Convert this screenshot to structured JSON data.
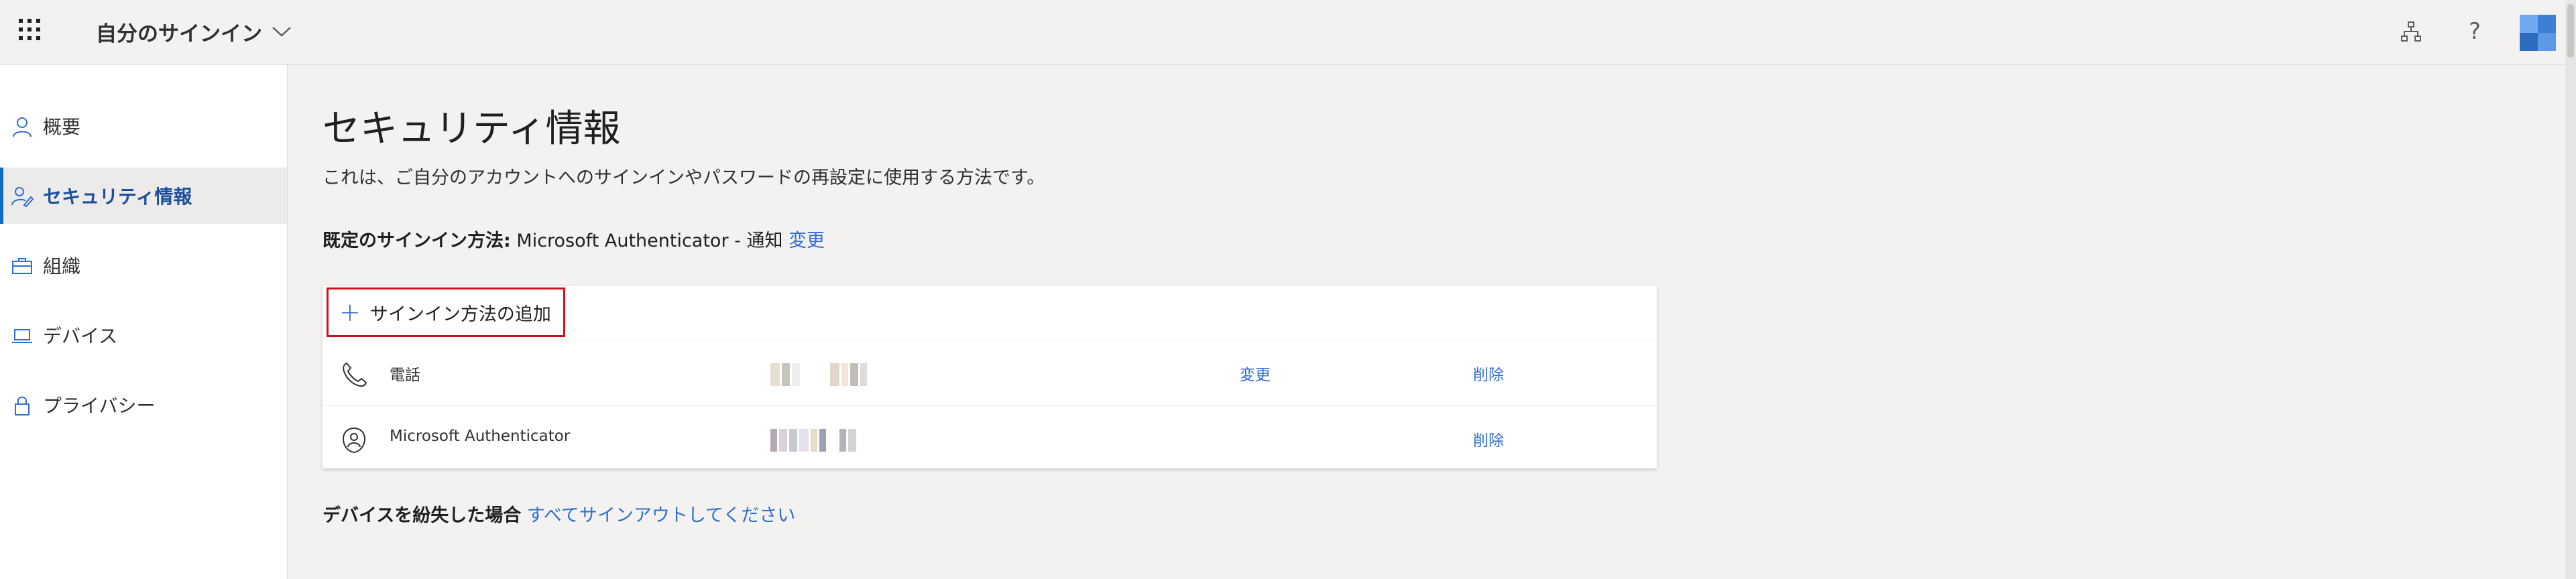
{
  "header": {
    "app_title": "自分のサインイン",
    "icons": [
      "waffle-icon",
      "chevron-down-icon",
      "org-chart-icon",
      "help-icon",
      "avatar"
    ],
    "help_label": "?"
  },
  "sidebar": {
    "items": [
      {
        "label": "概要",
        "icon": "person-icon",
        "active": false
      },
      {
        "label": "セキュリティ情報",
        "icon": "security-info-icon",
        "active": true
      },
      {
        "label": "組織",
        "icon": "briefcase-icon",
        "active": false
      },
      {
        "label": "デバイス",
        "icon": "laptop-icon",
        "active": false
      },
      {
        "label": "プライバシー",
        "icon": "lock-icon",
        "active": false
      }
    ]
  },
  "main": {
    "title": "セキュリティ情報",
    "description": "これは、ご自分のアカウントへのサインインやパスワードの再設定に使用する方法です。",
    "default_method_label": "既定のサインイン方法:",
    "default_method_value": "Microsoft Authenticator - 通知",
    "default_method_change": "変更",
    "add_method_label": "サインイン方法の追加",
    "methods": [
      {
        "name": "電話",
        "icon": "phone-icon",
        "change_label": "変更",
        "delete_label": "削除"
      },
      {
        "name": "Microsoft Authenticator",
        "icon": "authenticator-icon",
        "delete_label": "削除"
      }
    ],
    "lost_device_label": "デバイスを紛失した場合",
    "lost_device_link": "すべてサインアウトしてください"
  },
  "colors": {
    "accent": "#2f6fd0",
    "highlight_border": "#d0101b",
    "active_bar": "#0f6cbd"
  }
}
